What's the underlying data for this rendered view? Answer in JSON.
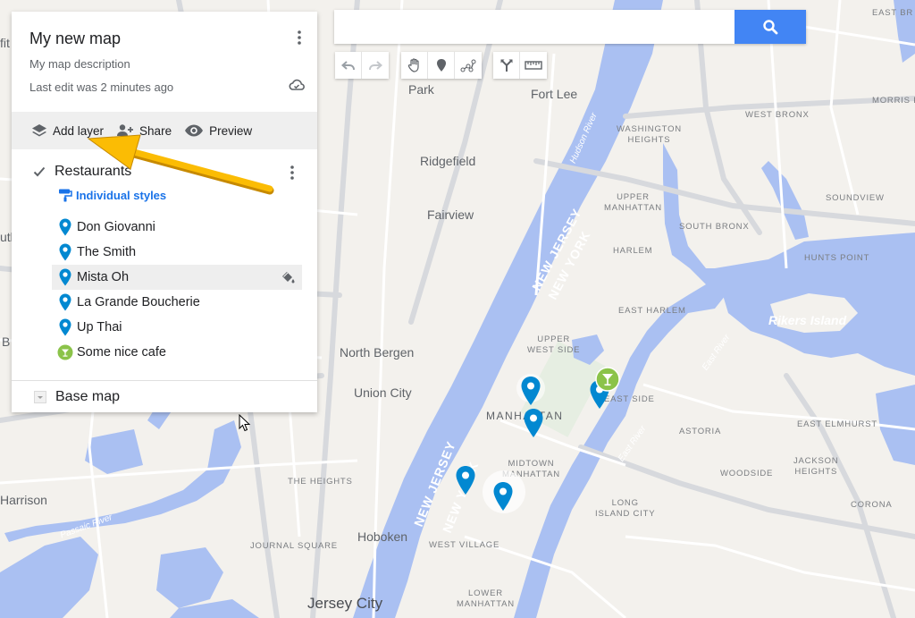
{
  "colors": {
    "land": "#f3f1ed",
    "water": "#aac0f2",
    "highway": "#d5d7db",
    "road": "#ffffff",
    "accent": "#4285f4",
    "marker_blue": "#0288d1",
    "marker_green": "#8bc34a",
    "arrow": "#fbbc04"
  },
  "search": {
    "placeholder": "",
    "value": "",
    "button_icon": "search-icon"
  },
  "toolbar": {
    "undo": "undo-icon",
    "redo": "redo-icon",
    "select": "hand-icon",
    "add_marker": "marker-icon",
    "draw_line": "line-icon",
    "directions": "directions-icon",
    "measure": "ruler-icon"
  },
  "panel": {
    "title": "My new map",
    "description": "My map description",
    "last_edit": "Last edit was 2 minutes ago",
    "actions": {
      "add_layer": "Add layer",
      "share": "Share",
      "preview": "Preview"
    },
    "layer": {
      "name": "Restaurants",
      "checked": true,
      "style_label": "Individual styles",
      "features": [
        {
          "name": "Don Giovanni",
          "icon": "blue-marker-icon"
        },
        {
          "name": "The Smith",
          "icon": "blue-marker-icon"
        },
        {
          "name": "Mista Oh",
          "icon": "blue-marker-icon",
          "hovered": true
        },
        {
          "name": "La Grande Boucherie",
          "icon": "blue-marker-icon"
        },
        {
          "name": "Up Thai",
          "icon": "blue-marker-icon"
        },
        {
          "name": "Some nice cafe",
          "icon": "cocktail-icon"
        }
      ]
    },
    "base_map": "Base map"
  },
  "map_labels": {
    "fort_lee": "Fort Lee",
    "park": "Park",
    "ridgefield": "Ridgefield",
    "fairview": "Fairview",
    "north_bergen": "North Bergen",
    "union_city": "Union City",
    "hoboken": "Hoboken",
    "jersey_city": "Jersey City",
    "harrison": "Harrison",
    "the_heights": "THE HEIGHTS",
    "journal_square": "JOURNAL SQUARE",
    "west_village": "WEST VILLAGE",
    "lower_manhattan": "LOWER\nMANHATTAN",
    "manhattan": "MANHATTAN",
    "midtown": "MIDTOWN\nMANHATTAN",
    "upper_west_side": "UPPER\nWEST SIDE",
    "upper_east_side": "EAST SIDE",
    "east_harlem": "EAST HARLEM",
    "harlem": "HARLEM",
    "upper_manhattan": "UPPER\nMANHATTAN",
    "washington_heights": "WASHINGTON\nHEIGHTS",
    "west_bronx": "WEST BRONX",
    "south_bronx": "SOUTH BRONX",
    "soundview": "SOUNDVIEW",
    "hunts_point": "HUNTS POINT",
    "morris_park": "MORRIS PA",
    "east_bronx": "EAST BR",
    "rikers_island": "Rikers Island",
    "astoria": "ASTORIA",
    "woodside": "WOODSIDE",
    "jackson_heights": "JACKSON\nHEIGHTS",
    "east_elmhurst": "EAST ELMHURST",
    "corona": "CORONA",
    "long_island_city": "LONG\nISLAND CITY",
    "hudson_river": "Hudson River",
    "east_river_1": "East River",
    "east_river_2": "East River",
    "passaic_river": "Passaic River",
    "new_jersey_1": "NEW JERSEY",
    "new_york_1": "NEW YORK",
    "new_jersey_2": "NEW JERSEY",
    "new_york_2": "NEW YORK",
    "edge_left_1": "fit",
    "edge_left_2": "utl",
    "edge_left_3": "B"
  }
}
